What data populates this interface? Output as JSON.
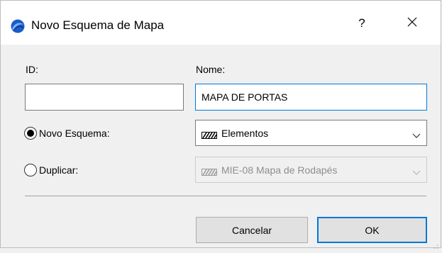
{
  "window": {
    "title": "Novo Esquema de Mapa",
    "help_label": "?",
    "icon": "archicad-app-icon",
    "close_icon": "close-icon"
  },
  "form": {
    "id_label": "ID:",
    "id_value": "",
    "name_label": "Nome:",
    "name_value": "MAPA DE PORTAS",
    "new_scheme_label": "Novo Esquema:",
    "new_scheme_selected": true,
    "new_scheme_option": "Elementos",
    "duplicate_label": "Duplicar:",
    "duplicate_selected": false,
    "duplicate_option": "MIE-08 Mapa de Rodapés"
  },
  "buttons": {
    "cancel_label": "Cancelar",
    "ok_label": "OK"
  },
  "colors": {
    "accent": "#0078d7",
    "dialog_bg": "#f0f0f0",
    "titlebar_bg": "#ffffff",
    "disabled_text": "#8e8e8e"
  }
}
